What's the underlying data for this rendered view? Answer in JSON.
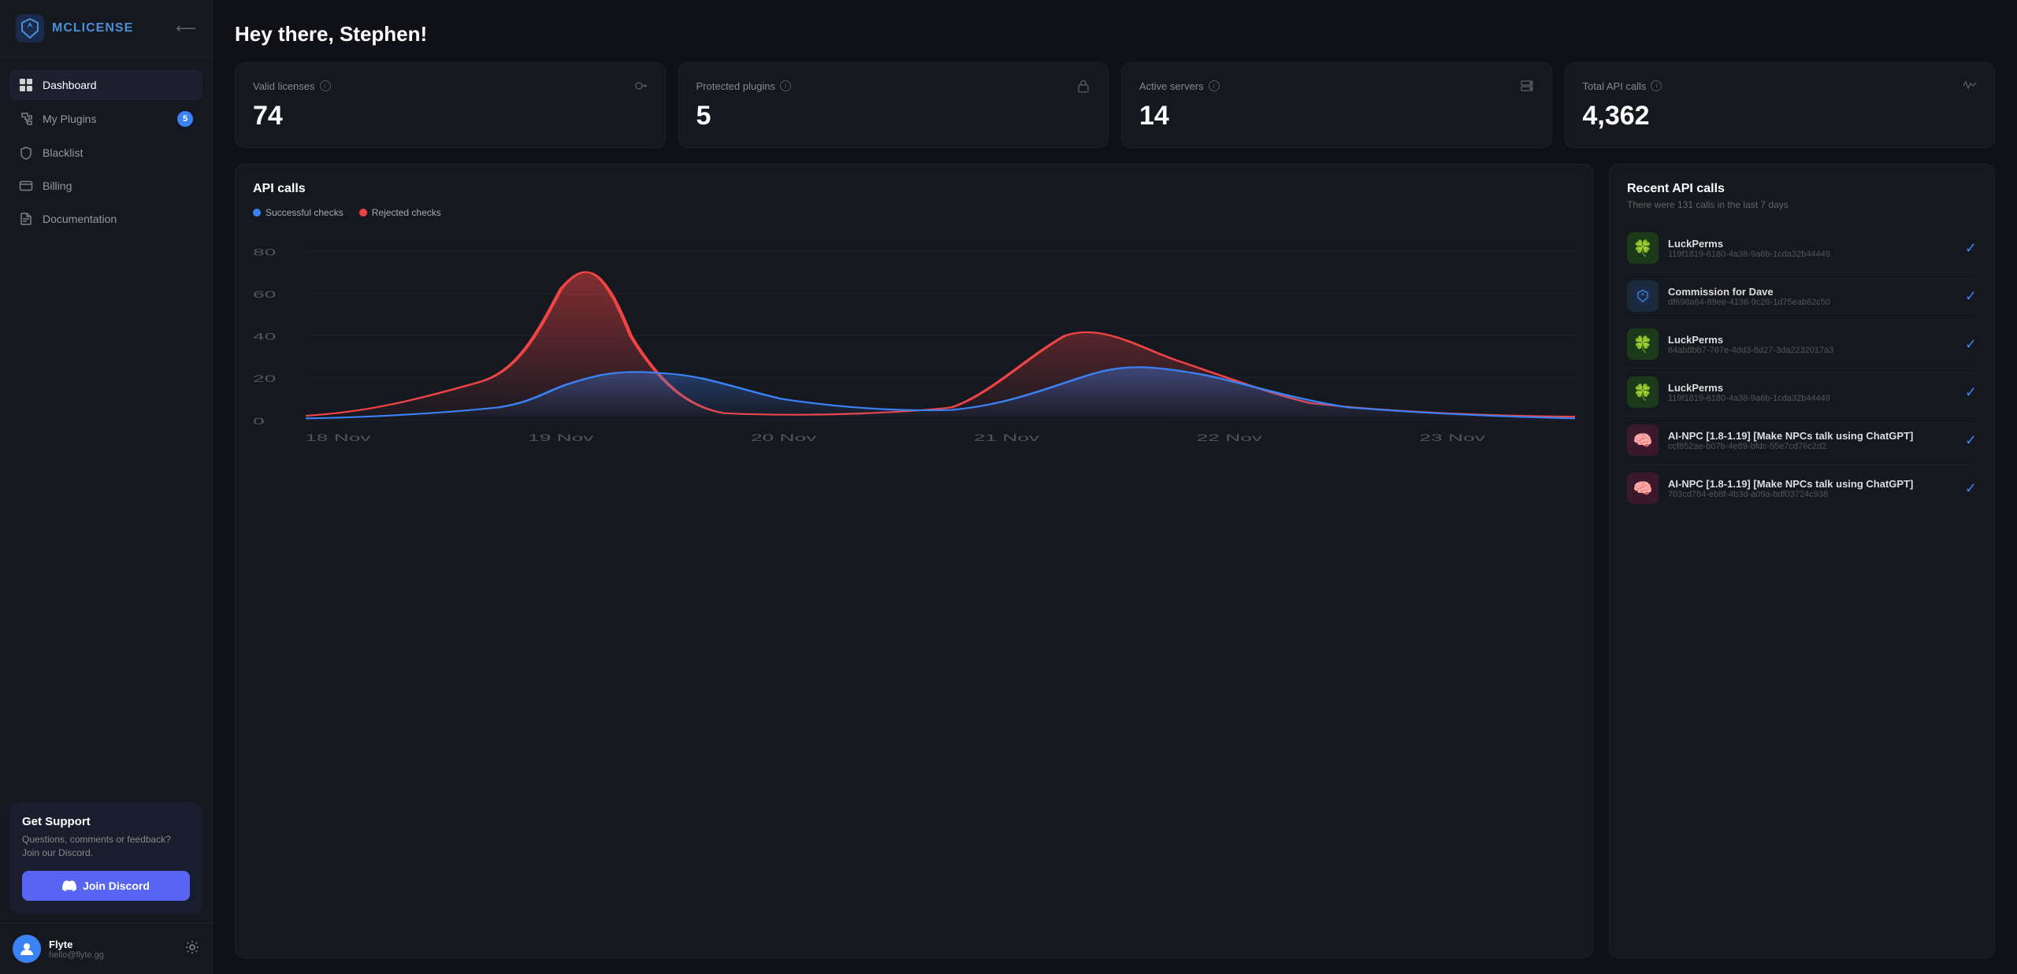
{
  "logo": {
    "text_bold": "MC",
    "text_light": "LICENSE"
  },
  "nav": {
    "items": [
      {
        "id": "dashboard",
        "label": "Dashboard",
        "icon": "grid",
        "active": true
      },
      {
        "id": "plugins",
        "label": "My Plugins",
        "icon": "puzzle",
        "active": false,
        "badge": "5"
      },
      {
        "id": "blacklist",
        "label": "Blacklist",
        "icon": "shield",
        "active": false
      },
      {
        "id": "billing",
        "label": "Billing",
        "icon": "credit-card",
        "active": false
      },
      {
        "id": "docs",
        "label": "Documentation",
        "icon": "file-text",
        "active": false
      }
    ]
  },
  "support": {
    "title": "Get Support",
    "description": "Questions, comments or feedback? Join our Discord.",
    "discord_label": "Join Discord"
  },
  "user": {
    "name": "Flyte",
    "email": "hello@flyte.gg"
  },
  "page_title": "Hey there, Stephen!",
  "stats": [
    {
      "label": "Valid licenses",
      "value": "74",
      "icon": "key"
    },
    {
      "label": "Protected plugins",
      "value": "5",
      "icon": "lock"
    },
    {
      "label": "Active servers",
      "value": "14",
      "icon": "server"
    },
    {
      "label": "Total API calls",
      "value": "4,362",
      "icon": "activity"
    }
  ],
  "chart": {
    "title": "API calls",
    "legend": [
      {
        "label": "Successful checks",
        "color": "#3b82f6"
      },
      {
        "label": "Rejected checks",
        "color": "#ef4444"
      }
    ],
    "x_labels": [
      "18 Nov",
      "19 Nov",
      "20 Nov",
      "21 Nov",
      "22 Nov",
      "23 Nov"
    ],
    "y_labels": [
      "0",
      "20",
      "40",
      "60",
      "80"
    ]
  },
  "api_calls": {
    "title": "Recent API calls",
    "subtitle": "There were 131 calls in the last 7 days",
    "items": [
      {
        "name": "LuckPerms",
        "uuid": "119f1819-6180-4a38-9a6b-1cda32b44449",
        "icon": "🍀",
        "icon_bg": "#1a3a1a",
        "verified": true
      },
      {
        "name": "Commission for Dave",
        "uuid": "df698a64-89ee-4136-9c26-1d75eab62c50",
        "icon": "🛡",
        "icon_bg": "#1a2a3a",
        "verified": true
      },
      {
        "name": "LuckPerms",
        "uuid": "64ab8bb7-767e-4dd3-8d27-3da2232017a3",
        "icon": "🍀",
        "icon_bg": "#1a3a1a",
        "verified": true
      },
      {
        "name": "LuckPerms",
        "uuid": "119f1819-6180-4a38-9a6b-1cda32b44449",
        "icon": "🍀",
        "icon_bg": "#1a3a1a",
        "verified": true
      },
      {
        "name": "AI-NPC [1.8-1.19] [Make NPCs talk using ChatGPT]",
        "uuid": "ccf852ae-b07b-4e89-bfdc-55e7cd76c2d2",
        "icon": "🧠",
        "icon_bg": "#3a1a2a",
        "verified": true
      },
      {
        "name": "AI-NPC [1.8-1.19] [Make NPCs talk using ChatGPT]",
        "uuid": "703cd784-eb8f-4b3d-a09a-bdf03724c938",
        "icon": "🧠",
        "icon_bg": "#3a1a2a",
        "verified": true
      }
    ]
  }
}
